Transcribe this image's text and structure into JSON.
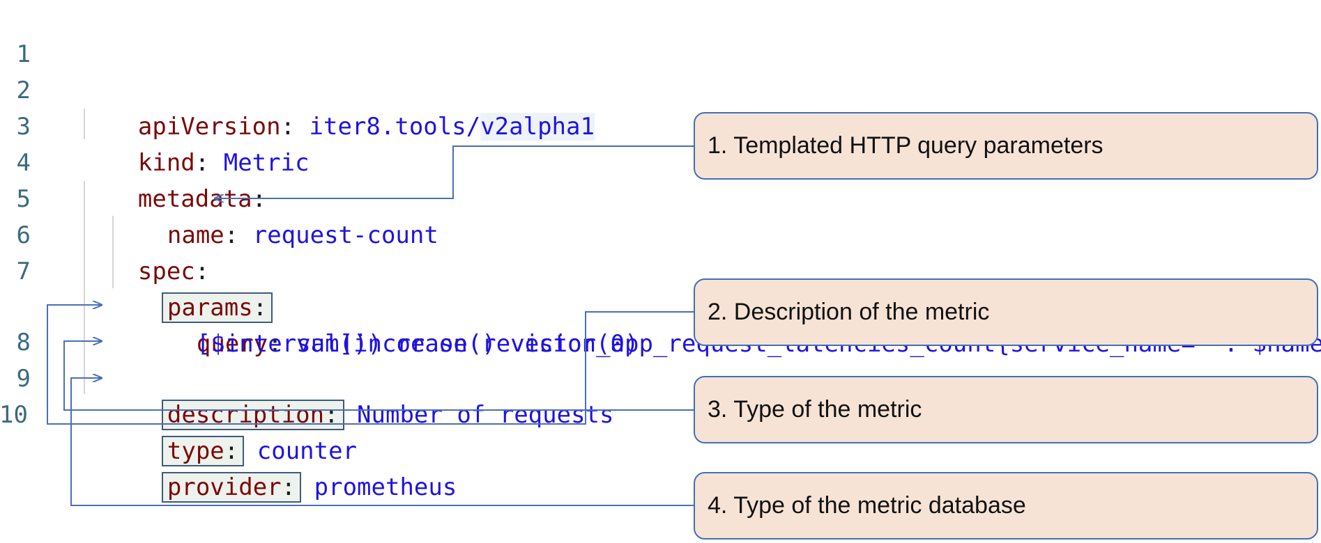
{
  "colors": {
    "key": "#7a0a0a",
    "value": "#1f13e0",
    "line_number": "#3b6a80",
    "callout_fill": "#f6e3d5",
    "callout_border": "#3f6fb8",
    "connector": "#4a6fb5"
  },
  "code": {
    "l1": {
      "num": "1",
      "key": "apiVersion",
      "value_a": "iter8.tools/",
      "value_b": "v2alpha1"
    },
    "l2": {
      "num": "2",
      "key": "kind",
      "value": "Metric"
    },
    "l3": {
      "num": "3",
      "key": "metadata"
    },
    "l4": {
      "num": "4",
      "key": "name",
      "value": "request-count"
    },
    "l5": {
      "num": "5",
      "key": "spec"
    },
    "l6": {
      "num": "6",
      "key": "params"
    },
    "l7": {
      "num": "7",
      "key": "query",
      "value": "sum(increase(revision_app_request_latencies_count{service_name=~'.*$name'}",
      "value_cont": "[$interval])) or on() vector(0)"
    },
    "l8": {
      "num": "8",
      "key": "description",
      "value": "Number of requests"
    },
    "l9": {
      "num": "9",
      "key": "type",
      "value": "counter"
    },
    "l10": {
      "num": "10",
      "key": "provider",
      "value": "prometheus"
    }
  },
  "callouts": [
    "1. Templated HTTP query parameters",
    "2. Description of the metric",
    "3. Type of the metric",
    "4. Type of the metric database"
  ]
}
